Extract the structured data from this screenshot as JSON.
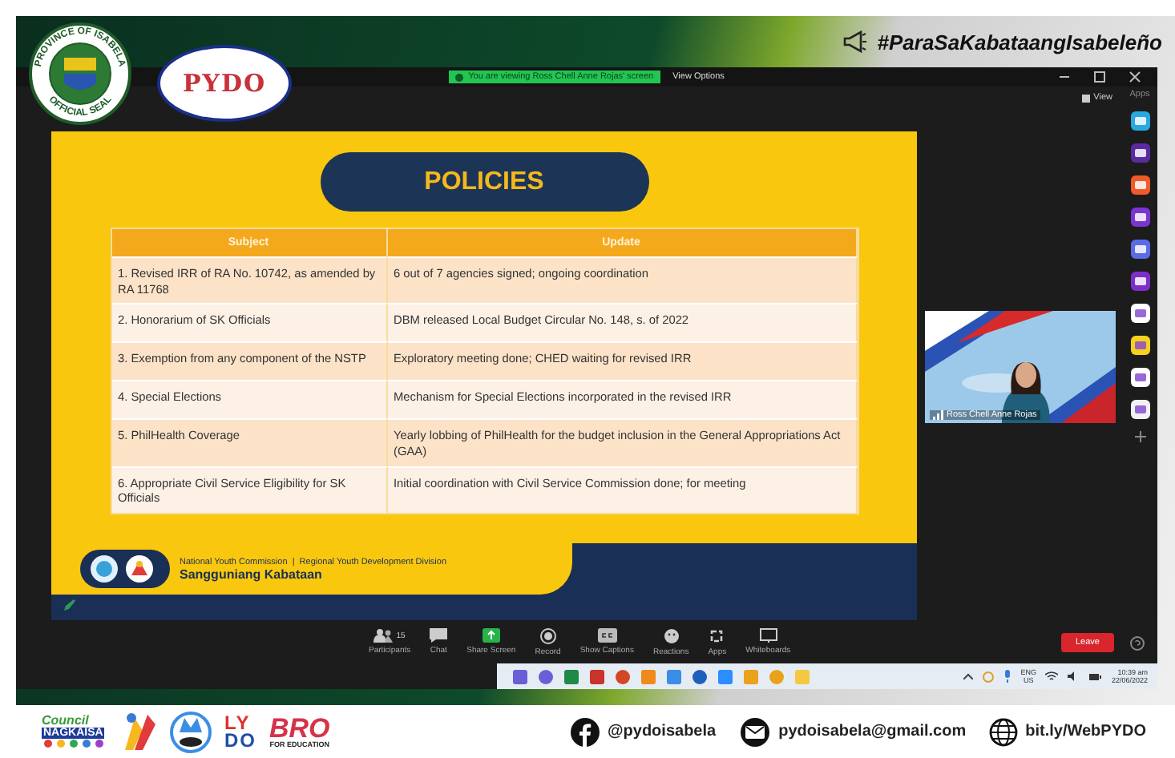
{
  "header": {
    "hashtag": "#ParaSaKabataangIsabeleño",
    "seal": {
      "top_text": "PROVINCE OF ISABELA",
      "bottom_text": "OFFICIAL SEAL"
    },
    "office_logo": {
      "text": "PYDO"
    }
  },
  "meeting": {
    "banner": "You are viewing Ross Chell Anne Rojas' screen",
    "view_options": "View Options",
    "view": "View",
    "apps": "Apps",
    "slide": {
      "title": "POLICIES",
      "columns": [
        "Subject",
        "Update"
      ],
      "rows": [
        {
          "subject": "1. Revised IRR of RA No. 10742, as amended by RA 11768",
          "update": "6 out of 7 agencies signed; ongoing coordination"
        },
        {
          "subject": "2. Honorarium of SK Officials",
          "update": "DBM released Local Budget Circular No. 148, s. of 2022"
        },
        {
          "subject": "3. Exemption from any component of the NSTP",
          "update": "Exploratory meeting done; CHED waiting for revised IRR"
        },
        {
          "subject": "4. Special Elections",
          "update": "Mechanism for Special Elections incorporated in the revised IRR"
        },
        {
          "subject": "5. PhilHealth Coverage",
          "update": "Yearly lobbing of PhilHealth for the budget inclusion in the General Appropriations Act (GAA)"
        },
        {
          "subject": "6. Appropriate Civil Service Eligibility for SK Officials",
          "update": "Initial coordination with Civil Service Commission done; for meeting"
        }
      ],
      "footer": {
        "line1": "National Youth Commission  |  Regional Youth Development Division",
        "line2": "Sangguniang Kabataan"
      }
    },
    "video": {
      "name": "Ross Chell Anne Rojas"
    },
    "toolbar": [
      {
        "kind": "participants",
        "label": "Participants",
        "count": "15"
      },
      {
        "kind": "chat",
        "label": "Chat"
      },
      {
        "kind": "share",
        "label": "Share Screen"
      },
      {
        "kind": "record",
        "label": "Record"
      },
      {
        "kind": "captions",
        "label": "Show Captions"
      },
      {
        "kind": "reactions",
        "label": "Reactions"
      },
      {
        "kind": "apps",
        "label": "Apps"
      },
      {
        "kind": "whiteboard",
        "label": "Whiteboards"
      }
    ],
    "leave": "Leave"
  },
  "taskbar": {
    "language": "ENG",
    "region": "US",
    "time": "10:39 am",
    "date": "22/06/2022"
  },
  "footer": {
    "logos": {
      "council": "Council",
      "council_sub": "NAGKAISA",
      "lydo_top": "LY",
      "lydo_bottom": "DO",
      "bro": "BRO",
      "bro_sub": "FOR EDUCATION"
    },
    "contacts": [
      {
        "kind": "facebook",
        "text": "@pydoisabela"
      },
      {
        "kind": "mail",
        "text": "pydoisabela@gmail.com"
      },
      {
        "kind": "web",
        "text": "bit.ly/WebPYDO"
      }
    ]
  }
}
